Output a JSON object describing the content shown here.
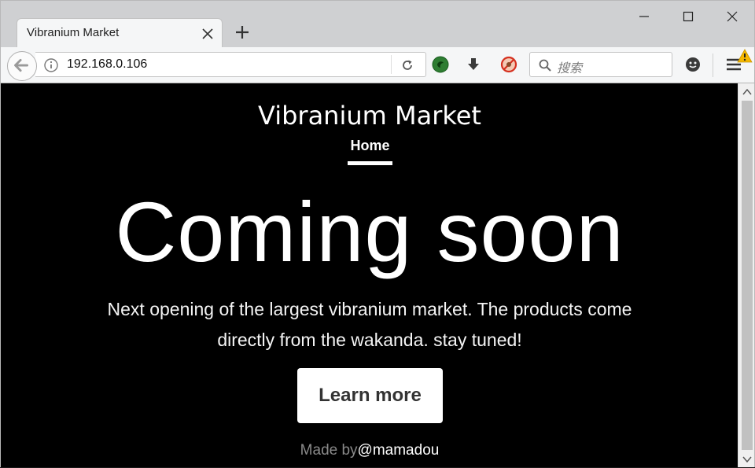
{
  "browser": {
    "tab_title": "Vibranium Market",
    "url": "192.168.0.106",
    "search_placeholder": "搜索"
  },
  "page": {
    "site_title": "Vibranium Market",
    "nav": {
      "home_label": "Home"
    },
    "hero": {
      "heading": "Coming soon",
      "text": "Next opening of the largest vibranium market. The products come directly from the wakanda. stay tuned!",
      "button_label": "Learn more"
    },
    "footer": {
      "made_by": "Made by",
      "author": "@mamadou"
    }
  },
  "colors": {
    "page_background": "#000000",
    "button_background": "#ffffff",
    "button_text": "#333333",
    "footer_muted": "#8a8a8a"
  },
  "icons": [
    "back-arrow-icon",
    "info-icon",
    "reload-icon",
    "extension-icon",
    "download-icon",
    "tracking-block-icon",
    "search-icon",
    "face-icon",
    "hamburger-menu-icon",
    "warning-icon",
    "close-tab-icon",
    "plus-icon",
    "minimize-icon",
    "maximize-icon",
    "close-window-icon"
  ]
}
